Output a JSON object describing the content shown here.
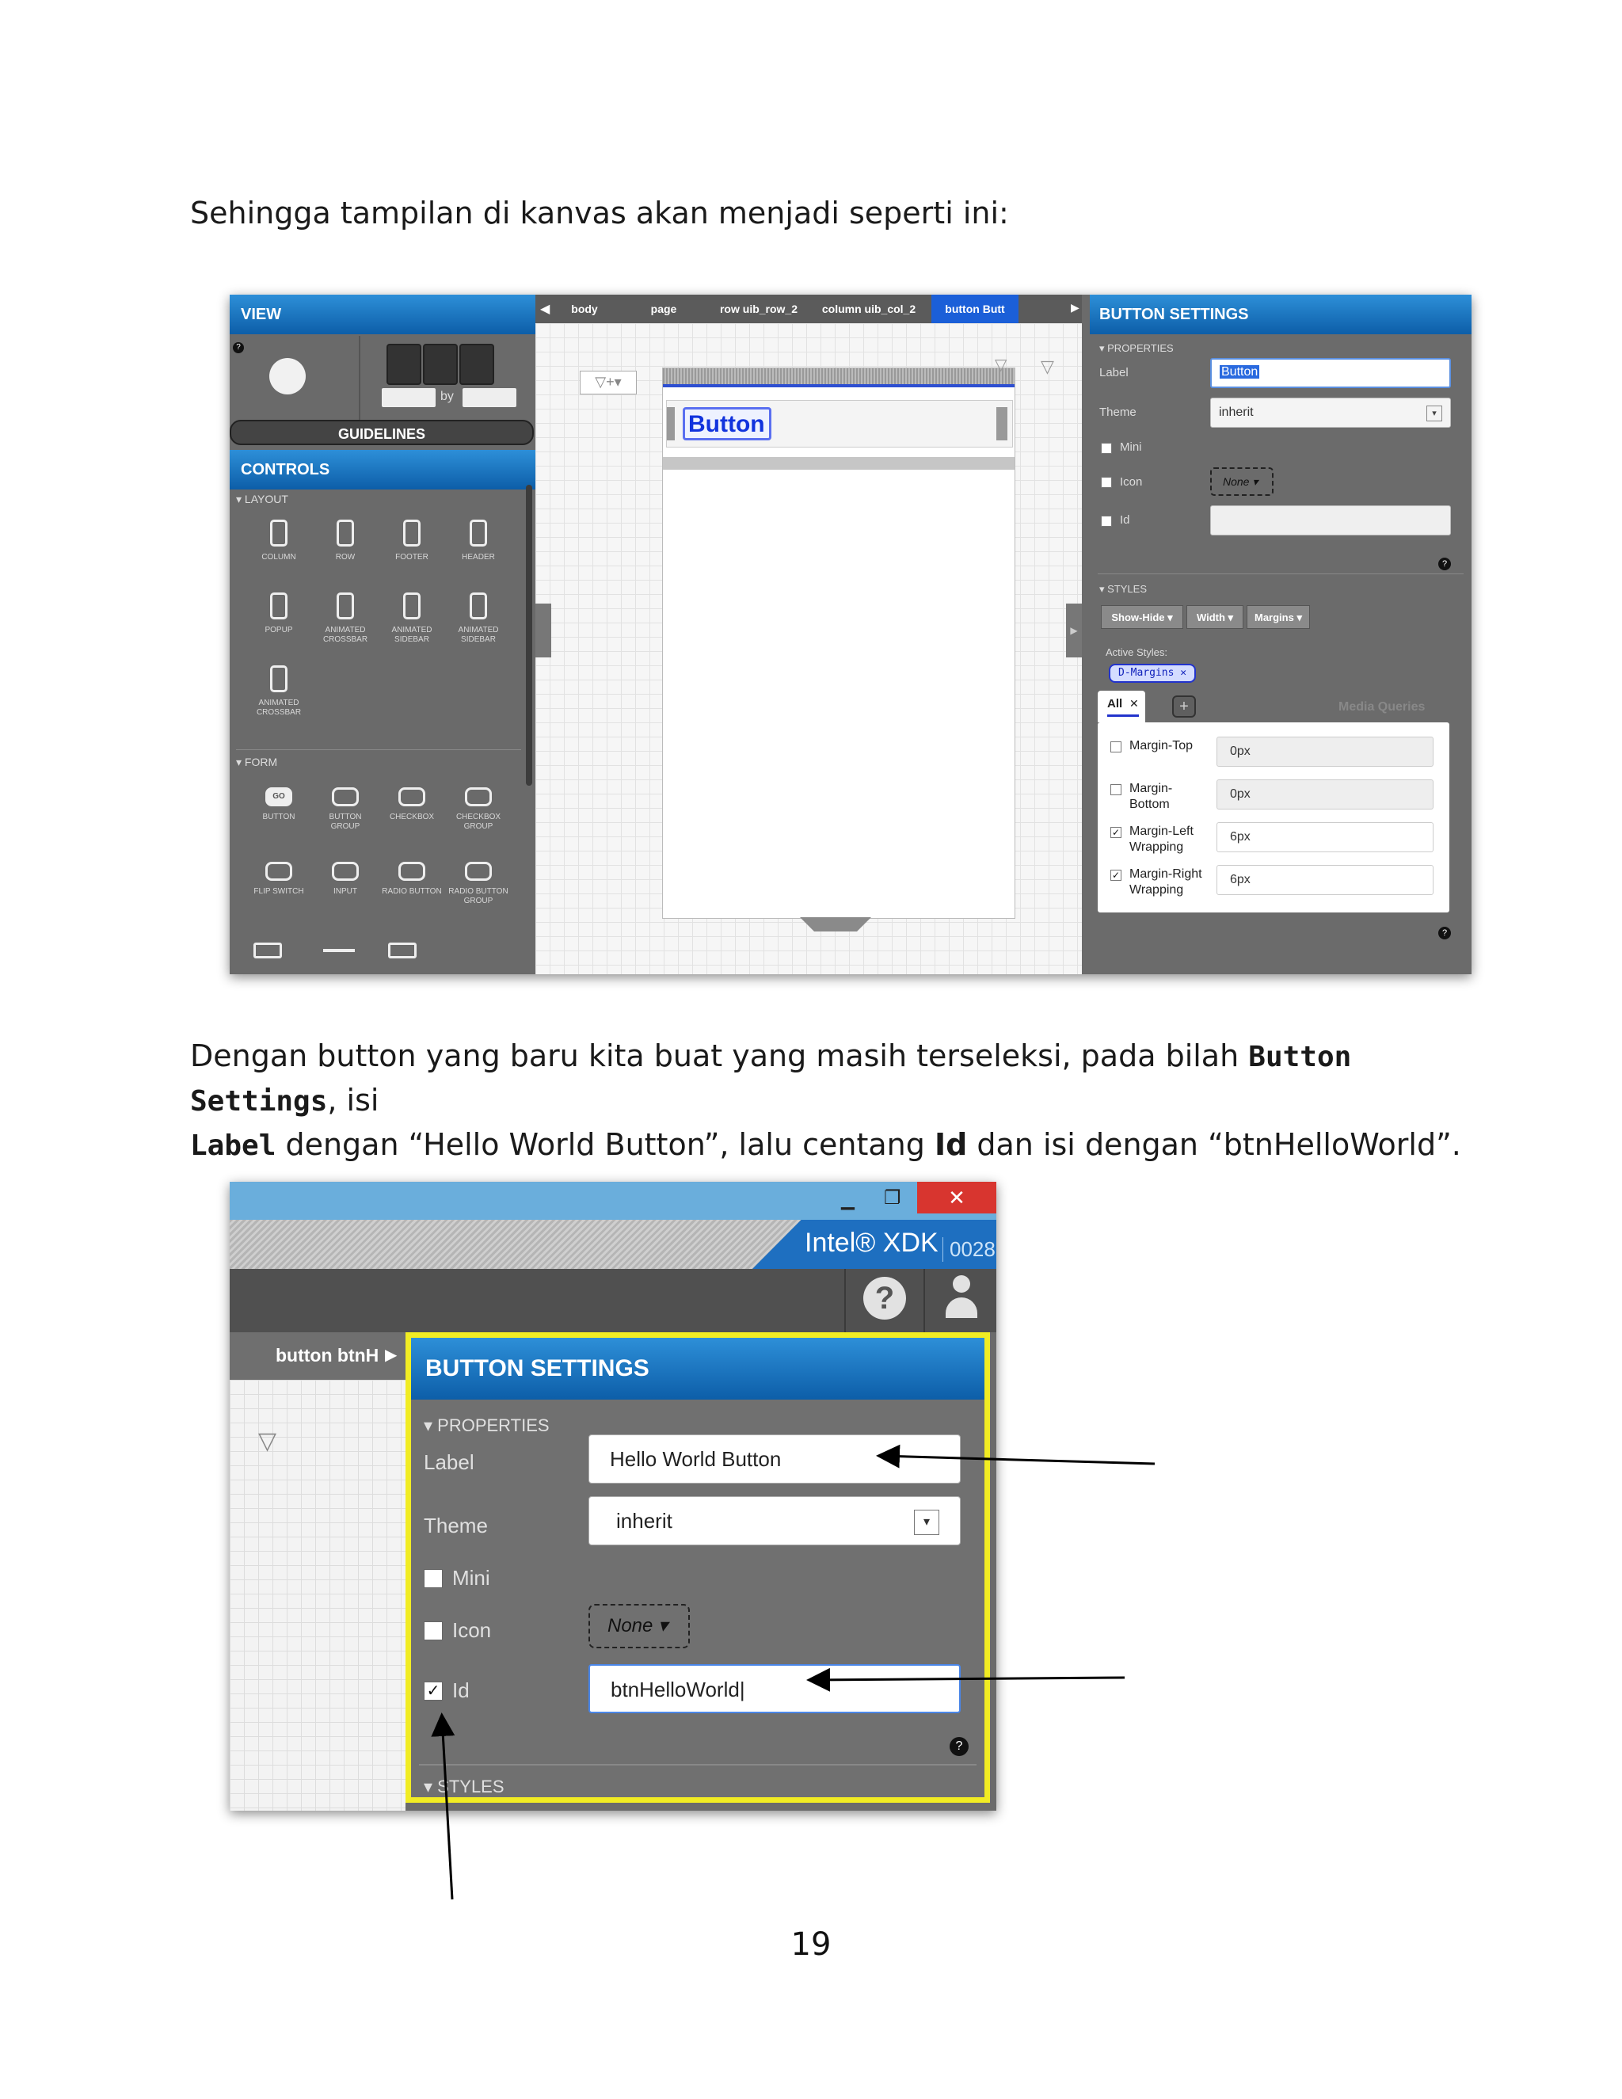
{
  "intro_text": "Sehingga tampilan di kanvas akan menjadi seperti ini:",
  "screenshot1": {
    "view_header": "VIEW",
    "by_label": "by",
    "guidelines_label": "GUIDELINES",
    "controls_header": "CONTROLS",
    "layout_section": "LAYOUT",
    "layout_controls": [
      "COLUMN",
      "ROW",
      "FOOTER",
      "HEADER",
      "POPUP",
      "ANIMATED CROSSBAR",
      "ANIMATED SIDEBAR",
      "ANIMATED SIDEBAR",
      "ANIMATED CROSSBAR"
    ],
    "form_section": "FORM",
    "form_controls": [
      "BUTTON",
      "BUTTON GROUP",
      "CHECKBOX",
      "CHECKBOX GROUP",
      "FLIP SWITCH",
      "INPUT",
      "RADIO BUTTON",
      "RADIO BUTTON GROUP"
    ],
    "go_label": "GO",
    "breadcrumbs": [
      "body",
      "page",
      "row uib_row_2",
      "column uib_col_2",
      "button Butt"
    ],
    "canvas_button_label": "Button",
    "settings_header": "BUTTON SETTINGS",
    "properties_section": "PROPERTIES",
    "label_label": "Label",
    "label_value": "Button",
    "theme_label": "Theme",
    "theme_value": "inherit",
    "mini_label": "Mini",
    "icon_label": "Icon",
    "icon_value": "None",
    "id_label": "Id",
    "styles_section": "STYLES",
    "style_buttons": [
      "Show-Hide",
      "Width",
      "Margins"
    ],
    "active_styles_label": "Active Styles:",
    "active_style_tag": "D-Margins",
    "tab_all": "All",
    "media_queries": "Media Queries",
    "margins": [
      {
        "label": "Margin-Top",
        "value": "0px",
        "checked": false
      },
      {
        "label": "Margin-\nBottom",
        "value": "0px",
        "checked": false
      },
      {
        "label": "Margin-Left\nWrapping",
        "value": "6px",
        "checked": true
      },
      {
        "label": "Margin-Right\nWrapping",
        "value": "6px",
        "checked": true
      }
    ]
  },
  "instruction": {
    "part1": "Dengan button yang baru kita buat yang masih terseleksi, pada bilah ",
    "bold1": "Button Settings",
    "part2": ", isi",
    "bold2": "Label",
    "part3": " dengan “Hello World Button”, lalu centang ",
    "bold3": "Id",
    "part4": " dan isi dengan “btnHelloWorld”."
  },
  "screenshot2": {
    "brand": "Intel® XDK",
    "build": "0028",
    "breadcrumb": "button btnH",
    "settings_header": "BUTTON SETTINGS",
    "properties_section": "PROPERTIES",
    "label_label": "Label",
    "label_value": "Hello World Button",
    "theme_label": "Theme",
    "theme_value": "inherit",
    "mini_label": "Mini",
    "icon_label": "Icon",
    "icon_value": "None",
    "id_label": "Id",
    "id_value": "btnHelloWorld",
    "styles_section": "STYLES"
  },
  "page_number": "19"
}
